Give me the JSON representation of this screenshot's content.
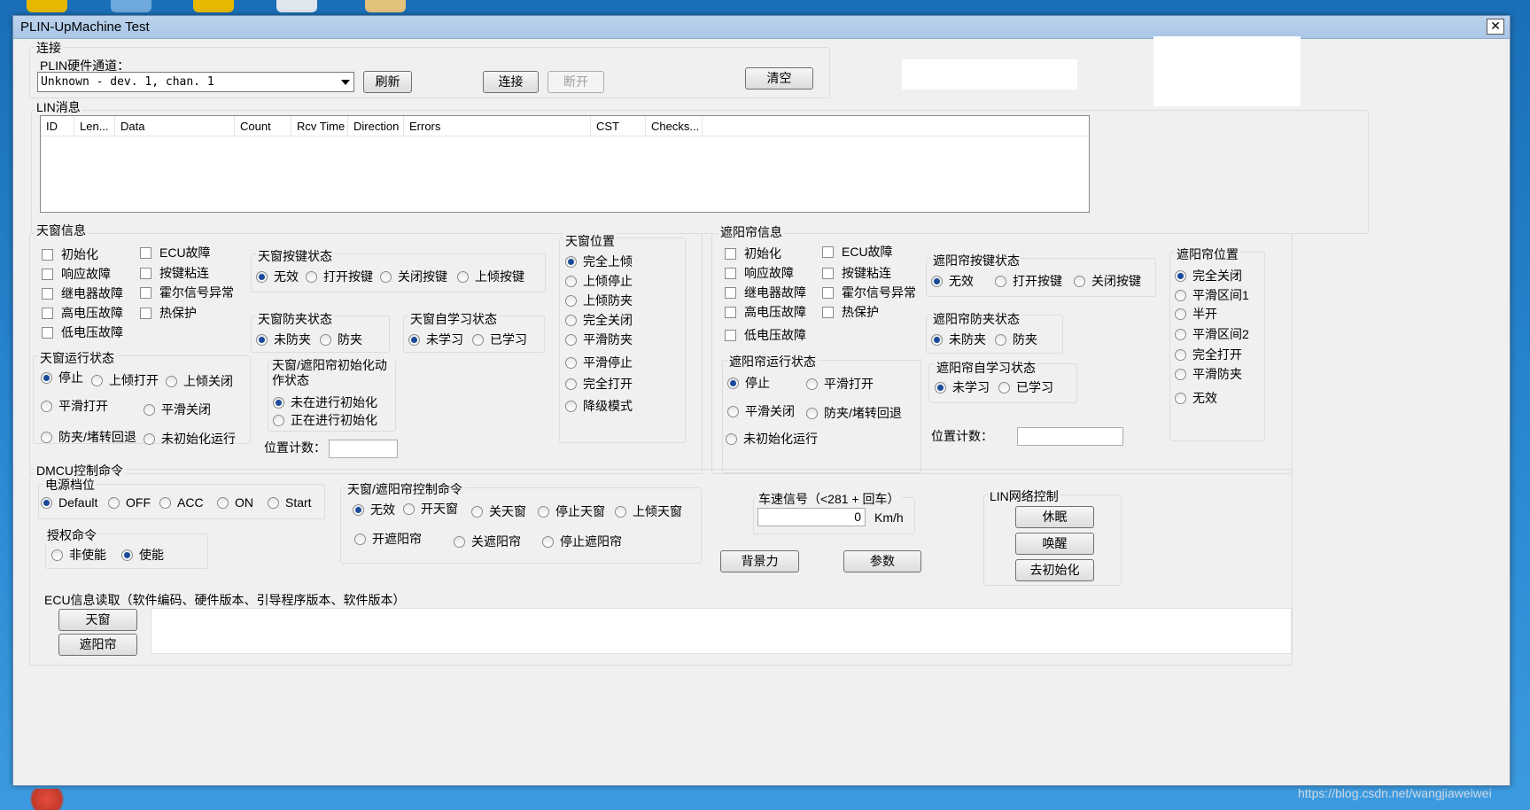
{
  "window": {
    "title": "PLIN-UpMachine Test",
    "close_label": "✕"
  },
  "connect": {
    "group_label": "连接",
    "hw_label": "PLIN硬件通道：",
    "hw_value": "Unknown - dev. 1, chan. 1",
    "refresh": "刷新",
    "connect": "连接",
    "disconnect": "断开",
    "clear": "清空"
  },
  "lin": {
    "group_label": "LIN消息",
    "columns": [
      "ID",
      "Len...",
      "Data",
      "Count",
      "Rcv Time",
      "Direction",
      "Errors",
      "CST",
      "Checks..."
    ]
  },
  "sunroof": {
    "group_label": "天窗信息",
    "faults": [
      "初始化",
      "ECU故障",
      "响应故障",
      "按键粘连",
      "继电器故障",
      "霍尔信号异常",
      "高电压故障",
      "热保护",
      "低电压故障"
    ],
    "key_state": {
      "label": "天窗按键状态",
      "options": [
        "无效",
        "打开按键",
        "关闭按键",
        "上倾按键"
      ]
    },
    "pinch_state": {
      "label": "天窗防夹状态",
      "options": [
        "未防夹",
        "防夹"
      ]
    },
    "learn_state": {
      "label": "天窗自学习状态",
      "options": [
        "未学习",
        "已学习"
      ]
    },
    "run_state": {
      "label": "天窗运行状态",
      "options": [
        "停止",
        "上倾打开",
        "上倾关闭",
        "平滑打开",
        "平滑关闭",
        "防夹/堵转回退",
        "未初始化运行"
      ]
    },
    "init_state": {
      "label": "天窗/遮阳帘初始化动作状态",
      "options": [
        "未在进行初始化",
        "正在进行初始化"
      ]
    },
    "pos_count_label": "位置计数：",
    "position": {
      "label": "天窗位置",
      "options": [
        "完全上倾",
        "上倾停止",
        "上倾防夹",
        "完全关闭",
        "平滑防夹",
        "平滑停止",
        "完全打开",
        "降级模式"
      ]
    }
  },
  "shade": {
    "group_label": "遮阳帘信息",
    "faults": [
      "初始化",
      "ECU故障",
      "响应故障",
      "按键粘连",
      "继电器故障",
      "霍尔信号异常",
      "高电压故障",
      "热保护",
      "低电压故障"
    ],
    "key_state": {
      "label": "遮阳帘按键状态",
      "options": [
        "无效",
        "打开按键",
        "关闭按键"
      ]
    },
    "pinch_state": {
      "label": "遮阳帘防夹状态",
      "options": [
        "未防夹",
        "防夹"
      ]
    },
    "learn_state": {
      "label": "遮阳帘自学习状态",
      "options": [
        "未学习",
        "已学习"
      ]
    },
    "run_state": {
      "label": "遮阳帘运行状态",
      "options": [
        "停止",
        "平滑打开",
        "平滑关闭",
        "防夹/堵转回退",
        "未初始化运行"
      ]
    },
    "pos_count_label": "位置计数：",
    "position": {
      "label": "遮阳帘位置",
      "options": [
        "完全关闭",
        "平滑区间1",
        "半开",
        "平滑区间2",
        "完全打开",
        "平滑防夹",
        "无效"
      ]
    }
  },
  "dmcu": {
    "group_label": "DMCU控制命令",
    "power": {
      "label": "电源档位",
      "options": [
        "Default",
        "OFF",
        "ACC",
        "ON",
        "Start"
      ]
    },
    "auth": {
      "label": "授权命令",
      "options": [
        "非使能",
        "使能"
      ]
    },
    "control": {
      "label": "天窗/遮阳帘控制命令",
      "options": [
        "无效",
        "开天窗",
        "关天窗",
        "停止天窗",
        "上倾天窗",
        "开遮阳帘",
        "关遮阳帘",
        "停止遮阳帘"
      ]
    },
    "speed": {
      "label": "车速信号（<281 + 回车）",
      "value": "0",
      "unit": "Km/h"
    },
    "backlight": "背景力",
    "params": "参数",
    "lin_net": {
      "label": "LIN网络控制",
      "sleep": "休眠",
      "wake": "唤醒",
      "deinit": "去初始化"
    },
    "ecu_info": {
      "label": "ECU信息读取（软件编码、硬件版本、引导程序版本、软件版本）",
      "sunroof": "天窗",
      "shade": "遮阳帘"
    }
  },
  "watermark": "https://blog.csdn.net/wangjiaweiwei"
}
